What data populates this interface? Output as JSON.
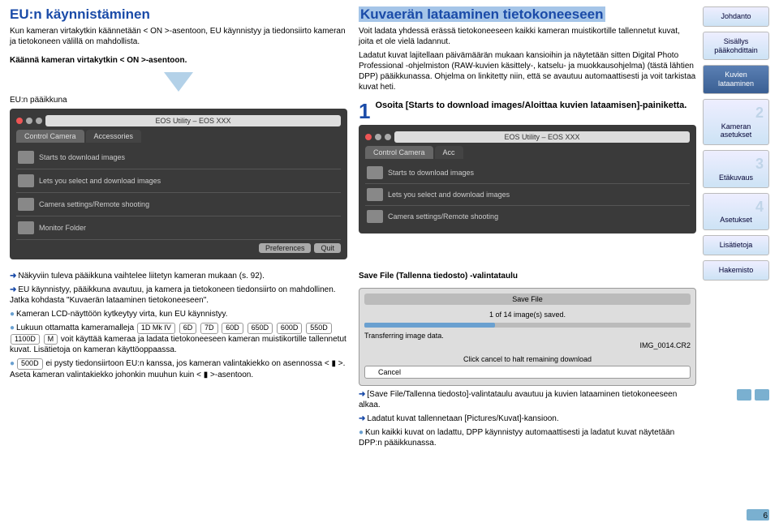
{
  "left": {
    "title": "EU:n käynnistäminen",
    "intro": "Kun kameran virtakytkin käännetään < ON >-asentoon, EU käynnistyy ja tiedonsiirto kameran ja tietokoneen välillä on mahdollista.",
    "step": "Käännä kameran virtakytkin < ON >-asentoon.",
    "panel_label": "EU:n pääikkuna",
    "panel_title": "EOS Utility – EOS XXX",
    "tab_control": "Control Camera",
    "tab_acc": "Accessories",
    "row1": "Starts to download images",
    "row2": "Lets you select and download images",
    "row3": "Camera settings/Remote shooting",
    "row4": "Monitor Folder",
    "btn_pref": "Preferences",
    "btn_quit": "Quit"
  },
  "right": {
    "title": "Kuvaerän lataaminen tietokoneeseen",
    "p1": "Voit ladata yhdessä erässä tietokoneeseen kaikki kameran muistikortille tallennetut kuvat, joita et ole vielä ladannut.",
    "p2": "Ladatut kuvat lajitellaan päivämäärän mukaan kansioihin ja näytetään sitten Digital Photo Professional -ohjelmiston (RAW-kuvien käsittely-, katselu- ja muokkausohjelma) (tästä lähtien DPP) pääikkunassa. Ohjelma on linkitetty niin, että se avautuu automaattisesti ja voit tarkistaa kuvat heti.",
    "step1_num": "1",
    "step1_text": "Osoita [Starts to download images/Aloittaa kuvien lataamisen]-painiketta.",
    "panel_title2": "EOS Utility – EOS XXX",
    "tab2_control": "Control Camera",
    "tab2_acc": "Acc",
    "r2_row1": "Starts to download images",
    "r2_row2": "Lets you select and download images",
    "r2_row3": "Camera settings/Remote shooting"
  },
  "lower_left": {
    "l1": "Näkyviin tuleva pääikkuna vaihtelee liitetyn kameran mukaan (s. 92).",
    "l2": "EU käynnistyy, pääikkuna avautuu, ja kamera ja tietokoneen tiedonsiirto on mahdollinen. Jatka kohdasta \"Kuvaerän lataaminen tietokoneeseen\".",
    "l3": "Kameran LCD-näyttöön kytkeytyy virta, kun EU käynnistyy.",
    "l4a": "Lukuun ottamatta kameramalleja ",
    "models1": [
      "1D Mk IV",
      "6D",
      "7D",
      "60D",
      "650D",
      "600D",
      "550D",
      "1100D",
      "M"
    ],
    "l4b": " voit käyttää kameraa ja ladata tietokoneeseen kameran muistikortille tallennetut kuvat. Lisätietoja on kameran käyttöoppaassa.",
    "l5_badge": "500D",
    "l5": " ei pysty tiedonsiirtoon EU:n kanssa, jos kameran valintakiekko on asennossa < ▮ >. Aseta kameran valintakiekko johonkin muuhun kuin < ▮ >-asentoon."
  },
  "lower_right": {
    "save_title": "Save File (Tallenna tiedosto) -valintataulu",
    "dlg_title": "Save File",
    "dlg_count": "1 of 14 image(s) saved.",
    "dlg_tx": "Transferring image data.",
    "dlg_file": "IMG_0014.CR2",
    "dlg_click": "Click cancel to halt remaining download",
    "dlg_cancel": "Cancel",
    "b1": "[Save File/Tallenna tiedosto]-valintataulu avautuu ja kuvien lataaminen tietokoneeseen alkaa.",
    "b2": "Ladatut kuvat tallennetaan [Pictures/Kuvat]-kansioon.",
    "b3": "Kun kaikki kuvat on ladattu, DPP käynnistyy automaattisesti ja ladatut kuvat näytetään DPP:n pääikkunassa."
  },
  "sidebar": {
    "s1": "Johdanto",
    "s2": "Sisällys pääkohdittain",
    "s3": "Kuvien lataaminen",
    "s4": "Kameran asetukset",
    "s5": "Etäkuvaus",
    "s6": "Asetukset",
    "s7": "Lisätietoja",
    "s8": "Hakemisto"
  },
  "pagenum": "6"
}
